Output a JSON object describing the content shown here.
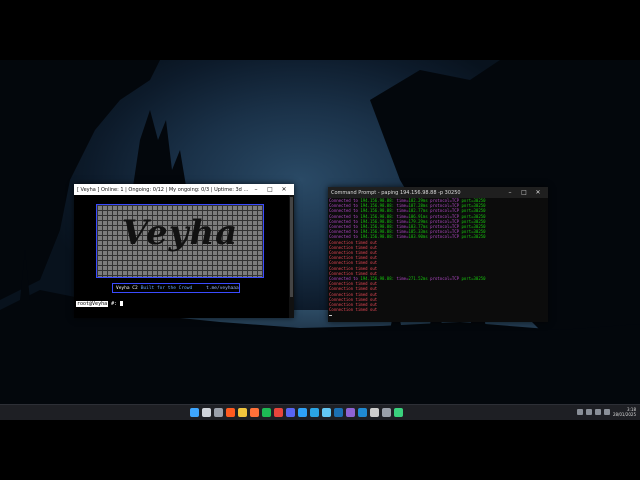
{
  "veyha_window": {
    "title": "[ Veyha ] Online: 1 | Ongoing: 0/12 | My ongoing: 0/3 | Uptime: 3d 05h 27m 23s |",
    "logo_text": "Veyha",
    "brand": "Veyha C2",
    "built_for": "Built for the Crowd",
    "link": "t.me/veyhaaa",
    "prompt_user": "root@Veyha",
    "prompt_symbol": "#:"
  },
  "cmd_window": {
    "title": "Command Prompt - paping 194.156.98.88 -p 30250",
    "success_rows": [
      {
        "ip": "194.156.98.88",
        "time": "182.29ms"
      },
      {
        "ip": "194.156.98.88",
        "time": "187.28ms"
      },
      {
        "ip": "194.156.98.88",
        "time": "182.77ms"
      },
      {
        "ip": "194.156.98.88",
        "time": "186.91ms"
      },
      {
        "ip": "194.156.98.88",
        "time": "179.29ms"
      },
      {
        "ip": "194.156.98.88",
        "time": "183.77ms"
      },
      {
        "ip": "194.156.98.88",
        "time": "185.33ms"
      },
      {
        "ip": "194.156.98.88",
        "time": "183.90ms"
      }
    ],
    "timeout_text": "Connection timed out",
    "late_success": {
      "ip": "194.156.98.88",
      "time": "271.52ms"
    },
    "connected_to": "Connected to",
    "protocol": "protocol=TCP",
    "port": "port=30250"
  },
  "window_controls": {
    "minimize": "–",
    "maximize": "□",
    "close": "✕"
  },
  "taskbar": {
    "icons": [
      "windows-start",
      "search",
      "task-view",
      "brave",
      "file-explorer",
      "firefox",
      "spotify",
      "chrome",
      "discord",
      "edge",
      "telegram",
      "notepad",
      "steam",
      "visual-studio",
      "vscode",
      "terminal",
      "settings",
      "app"
    ],
    "colors": [
      "#3ea6ff",
      "#d0d4db",
      "#9aa0aa",
      "#ff5a1f",
      "#f2c53d",
      "#ff7139",
      "#1db954",
      "#e8453c",
      "#5865f2",
      "#2ea2f8",
      "#2aa4e4",
      "#63c7f4",
      "#1b6fb2",
      "#8e63d4",
      "#1f8ad2",
      "#cccccc",
      "#9aa0aa",
      "#3ad17d"
    ],
    "time": "3:18",
    "date": "28/01/2025"
  }
}
